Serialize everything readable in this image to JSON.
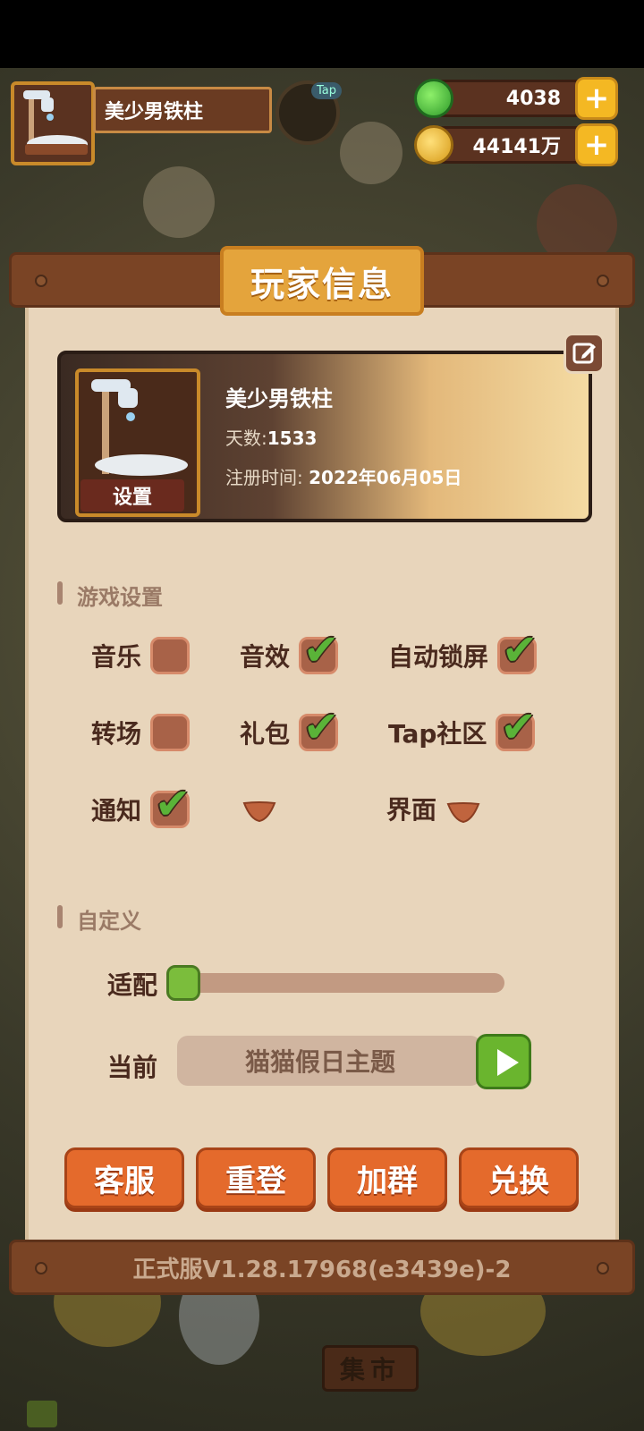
{
  "player": {
    "name": "美少男铁柱",
    "days_label": "天数:",
    "days_value": "1533",
    "register_label": "注册时间:",
    "register_value": "2022年06月05日",
    "settings_tag": "设置"
  },
  "hud": {
    "tap_badge": "Tap",
    "jade": {
      "value": "4038",
      "icon": "jade-icon"
    },
    "coins": {
      "value": "44141万",
      "icon": "coin-icon"
    },
    "plus": "+"
  },
  "panel": {
    "title": "玩家信息"
  },
  "game_settings": {
    "title": "游戏设置",
    "options": {
      "music": {
        "label": "音乐",
        "checked": false
      },
      "sfx": {
        "label": "音效",
        "checked": true
      },
      "autolock": {
        "label": "自动锁屏",
        "checked": true
      },
      "transition": {
        "label": "转场",
        "checked": false
      },
      "gift": {
        "label": "礼包",
        "checked": true
      },
      "tap_community": {
        "label": "Tap社区",
        "checked": true
      },
      "notify": {
        "label": "通知",
        "checked": true
      },
      "interface": {
        "label": "界面"
      }
    }
  },
  "custom": {
    "title": "自定义",
    "adapt_label": "适配",
    "adapt_value": 0,
    "current_label": "当前",
    "current_theme": "猫猫假日主题"
  },
  "buttons": {
    "service": "客服",
    "relogin": "重登",
    "join_group": "加群",
    "redeem": "兑换"
  },
  "version": "正式服V1.28.17968(e3439e)-2",
  "background": {
    "market": "集市"
  },
  "colors": {
    "panel": "#e8d5bb",
    "wood": "#7a4425",
    "button_orange": "#e46a2c",
    "check_green": "#5ab338",
    "title_gold": "#e4a43c"
  }
}
